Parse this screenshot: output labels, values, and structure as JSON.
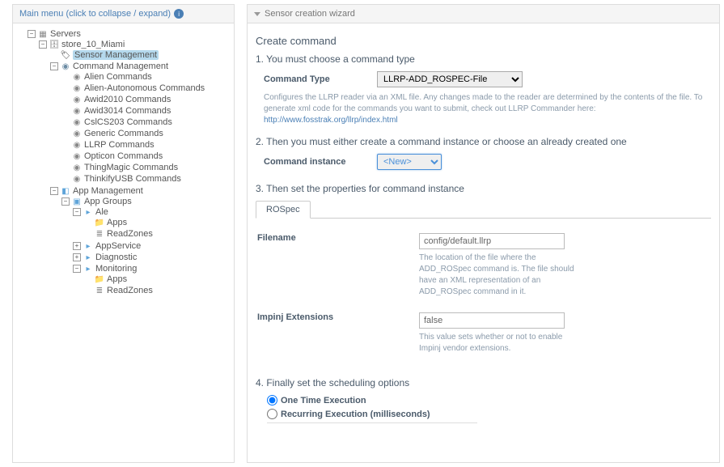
{
  "left": {
    "header": "Main menu (click to collapse / expand)",
    "tree": {
      "servers": "Servers",
      "store": "store_10_Miami",
      "sensor_mgmt": "Sensor Management",
      "command_mgmt": "Command Management",
      "cmds": {
        "alien": "Alien Commands",
        "alien_auto": "Alien-Autonomous Commands",
        "awid2010": "Awid2010 Commands",
        "awid3014": "Awid3014 Commands",
        "csl": "CslCS203 Commands",
        "generic": "Generic Commands",
        "llrp": "LLRP Commands",
        "opticon": "Opticon Commands",
        "thingmagic": "ThingMagic Commands",
        "thinkify": "ThinkifyUSB Commands"
      },
      "app_mgmt": "App Management",
      "app_groups": "App Groups",
      "ale": "Ale",
      "apps1": "Apps",
      "readzones1": "ReadZones",
      "appservice": "AppService",
      "diagnostic": "Diagnostic",
      "monitoring": "Monitoring",
      "apps2": "Apps",
      "readzones2": "ReadZones"
    }
  },
  "right": {
    "header": "Sensor creation wizard",
    "title": "Create command",
    "step1": "1. You must choose a command type",
    "command_type_label": "Command Type",
    "command_type_value": "LLRP-ADD_ROSPEC-File",
    "command_type_help_1": "Configures the LLRP reader via an XML file. Any changes made to the reader are determined by the contents of the file. To generate xml code for the commands you want to submit, check out LLRP Commander here: ",
    "command_type_help_link": "http://www.fosstrak.org/llrp/index.html",
    "step2": "2. Then you must either create a command instance or choose an already created one",
    "command_instance_label": "Command instance",
    "command_instance_value": "<New>",
    "step3": "3. Then set the properties for command instance",
    "tab": "ROSpec",
    "filename_label": "Filename",
    "filename_value": "config/default.llrp",
    "filename_desc": "The location of the file where the ADD_ROSpec command is. The file should have an XML representation of an ADD_ROSpec command in it.",
    "impinj_label": "Impinj Extensions",
    "impinj_value": "false",
    "impinj_desc": "This value sets whether or not to enable Impinj vendor extensions.",
    "step4": "4. Finally set the scheduling options",
    "radio_once": "One Time Execution",
    "radio_recurring": "Recurring Execution (milliseconds)"
  }
}
